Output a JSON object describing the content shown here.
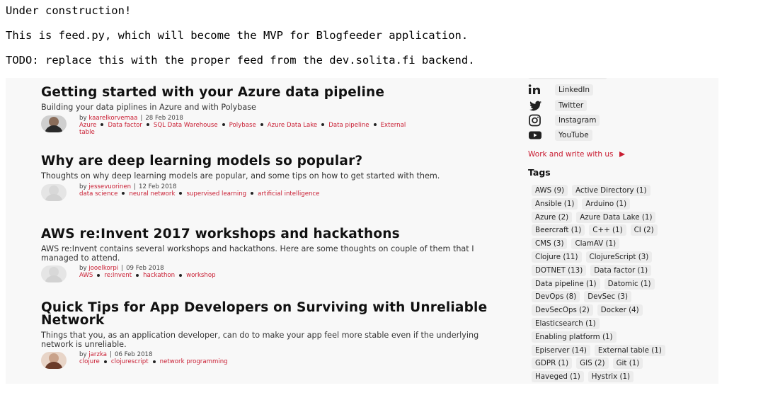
{
  "notice": {
    "line1": "Under construction!",
    "line2": "This is feed.py, which will become the MVP for Blogfeeder application.",
    "line3": "TODO: replace this with the proper feed from the dev.solita.fi backend."
  },
  "articles": [
    {
      "title": "Getting started with your Azure data pipeline",
      "subtitle": "Building your data piplines in Azure and with Polybase",
      "by": "by",
      "author": "kaarelkorvemaa",
      "date": "28 Feb 2018",
      "tags": [
        "Azure",
        "Data factor",
        "SQL Data Warehouse",
        "Polybase",
        "Azure Data Lake",
        "Data pipeline",
        "External",
        "table"
      ]
    },
    {
      "title": "Why are deep learning models so popular?",
      "subtitle": "Thoughts on why deep learning models are popular, and some tips on how to get started with them.",
      "by": "by",
      "author": "jessevuorinen",
      "date": "12 Feb 2018",
      "tags": [
        "data science",
        "neural network",
        "supervised learning",
        "artificial intelligence"
      ]
    },
    {
      "title": "AWS re:Invent 2017 workshops and hackathons",
      "subtitle": "AWS re:Invent contains several workshops and hackathons. Here are some thoughts on couple of them that I managed to attend.",
      "by": "by",
      "author": "jooelkorpi",
      "date": "09 Feb 2018",
      "tags": [
        "AWS",
        "re:Invent",
        "hackathon",
        "workshop"
      ]
    },
    {
      "title": "Quick Tips for App Developers on Surviving with Unreliable Network",
      "subtitle": "Things that you, as an application developer, can do to make your app feel more stable even if the underlying network is unreliable.",
      "by": "by",
      "author": "jarzka",
      "date": "06 Feb 2018",
      "tags": [
        "clojure",
        "clojurescript",
        "network programming"
      ]
    }
  ],
  "sidebar": {
    "social": [
      {
        "label": "LinkedIn",
        "icon": "linkedin-icon"
      },
      {
        "label": "Twitter",
        "icon": "twitter-icon"
      },
      {
        "label": "Instagram",
        "icon": "instagram-icon"
      },
      {
        "label": "YouTube",
        "icon": "youtube-icon"
      }
    ],
    "work_link": "Work and write with us",
    "tags_heading": "Tags",
    "tag_rows": [
      [
        "AWS (9)",
        "Active Directory (1)"
      ],
      [
        "Ansible (1)",
        "Arduino (1)"
      ],
      [
        "Azure (2)",
        "Azure Data Lake (1)"
      ],
      [
        "Beercraft (1)",
        "C++ (1)",
        "CI (2)"
      ],
      [
        "CMS (3)",
        "ClamAV (1)"
      ],
      [
        "Clojure (11)",
        "ClojureScript (3)"
      ],
      [
        "DOTNET (13)",
        "Data factor (1)"
      ],
      [
        "Data pipeline (1)",
        "Datomic (1)"
      ],
      [
        "DevOps (8)",
        "DevSec (3)"
      ],
      [
        "DevSecOps (2)",
        "Docker (4)"
      ],
      [
        "Elasticsearch (1)"
      ],
      [
        "Enabling platform (1)"
      ],
      [
        "Episerver (14)",
        "External table (1)"
      ],
      [
        "GDPR (1)",
        "GIS (2)",
        "Git (1)"
      ],
      [
        "Haveged (1)",
        "Hystrix (1)"
      ]
    ]
  },
  "colors": {
    "accent": "#c91d32",
    "panel_background": "#f8f8f8",
    "chip_background": "#ececec"
  }
}
